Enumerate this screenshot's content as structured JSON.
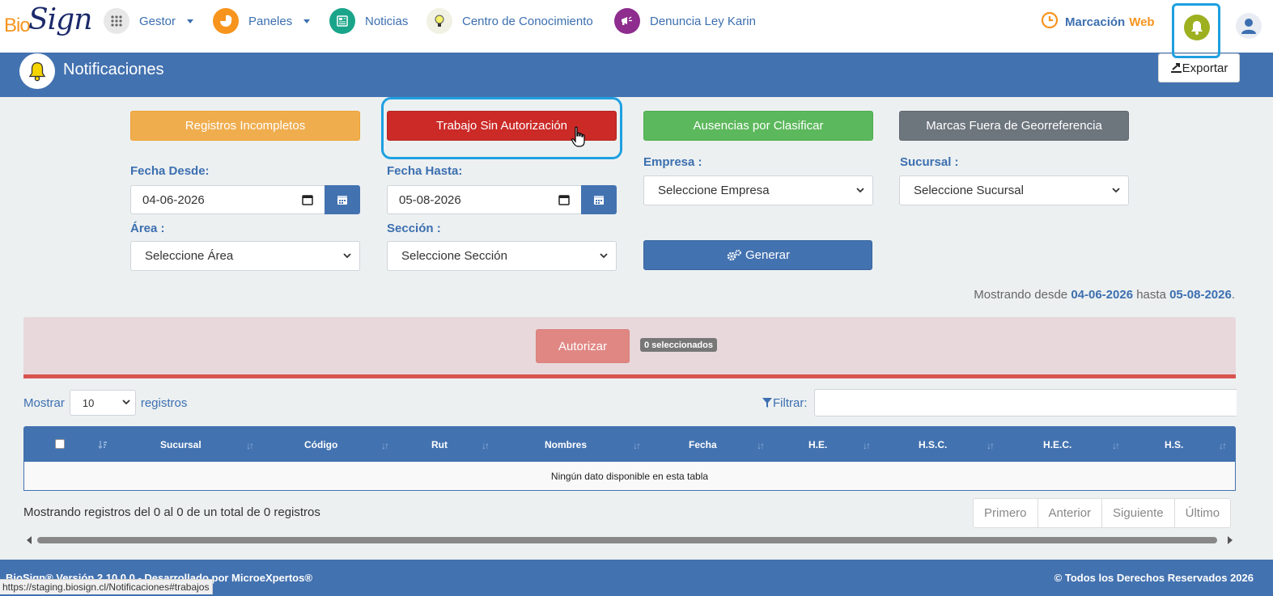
{
  "nav": {
    "logo_bio": "Bio",
    "logo_sign": "Sign",
    "items": [
      {
        "label": "Gestor",
        "icon": "apps-grid-icon",
        "has_caret": true
      },
      {
        "label": "Paneles",
        "icon": "pie-chart-icon",
        "has_caret": true
      },
      {
        "label": "Noticias",
        "icon": "newspaper-icon",
        "has_caret": false
      },
      {
        "label": "Centro de Conocimiento",
        "icon": "lightbulb-icon",
        "has_caret": false
      },
      {
        "label": "Denuncia Ley Karin",
        "icon": "megaphone-icon",
        "has_caret": false
      }
    ],
    "marcacion_part1": "Marcación",
    "marcacion_part2": "Web"
  },
  "header": {
    "title": "Notificaciones",
    "export_label": "Exportar"
  },
  "tabs": {
    "incompletos": "Registros Incompletos",
    "sin_autorizacion": "Trabajo Sin Autorización",
    "ausencias": "Ausencias por Clasificar",
    "georreferencia": "Marcas Fuera de Georreferencia"
  },
  "filters": {
    "fecha_desde_label": "Fecha Desde:",
    "fecha_desde_value": "04-06-2026",
    "fecha_hasta_label": "Fecha Hasta:",
    "fecha_hasta_value": "05-08-2026",
    "empresa_label": "Empresa :",
    "empresa_value": "Seleccione Empresa",
    "sucursal_label": "Sucursal :",
    "sucursal_value": "Seleccione Sucursal",
    "area_label": "Área :",
    "area_value": "Seleccione Área",
    "seccion_label": "Sección :",
    "seccion_value": "Seleccione Sección",
    "generar_label": "Generar"
  },
  "range": {
    "prefix": "Mostrando desde",
    "from": "04-06-2026",
    "middle": "hasta",
    "to": "05-08-2026",
    "suffix": "."
  },
  "authorize": {
    "button_label": "Autorizar",
    "selected_badge": "0 seleccionados"
  },
  "table_controls": {
    "show_label": "Mostrar",
    "page_size": "10",
    "records_label": "registros",
    "filter_label": "Filtrar:",
    "filter_value": ""
  },
  "table": {
    "columns": [
      "Sucursal",
      "Código",
      "Rut",
      "Nombres",
      "Fecha",
      "H.E.",
      "H.S.C.",
      "H.E.C.",
      "H.S."
    ],
    "empty_message": "Ningún dato disponible en esta tabla"
  },
  "pagination": {
    "info": "Mostrando registros del 0 al 0 de un total de 0 registros",
    "first": "Primero",
    "prev": "Anterior",
    "next": "Siguiente",
    "last": "Último"
  },
  "footer": {
    "left": "BioSign® Versión 2.10.0.0 - Desarrollado por MicroeXpertos®",
    "right": "© Todos los Derechos Reservados 2026"
  },
  "status_url": "https://staging.biosign.cl/Notificaciones#trabajos",
  "colors": {
    "primary": "#4372b0",
    "orange": "#f0ad4e",
    "red": "#cb2a27",
    "green": "#5cb85c",
    "gray": "#6d757d",
    "highlight": "#1ea0e0"
  }
}
